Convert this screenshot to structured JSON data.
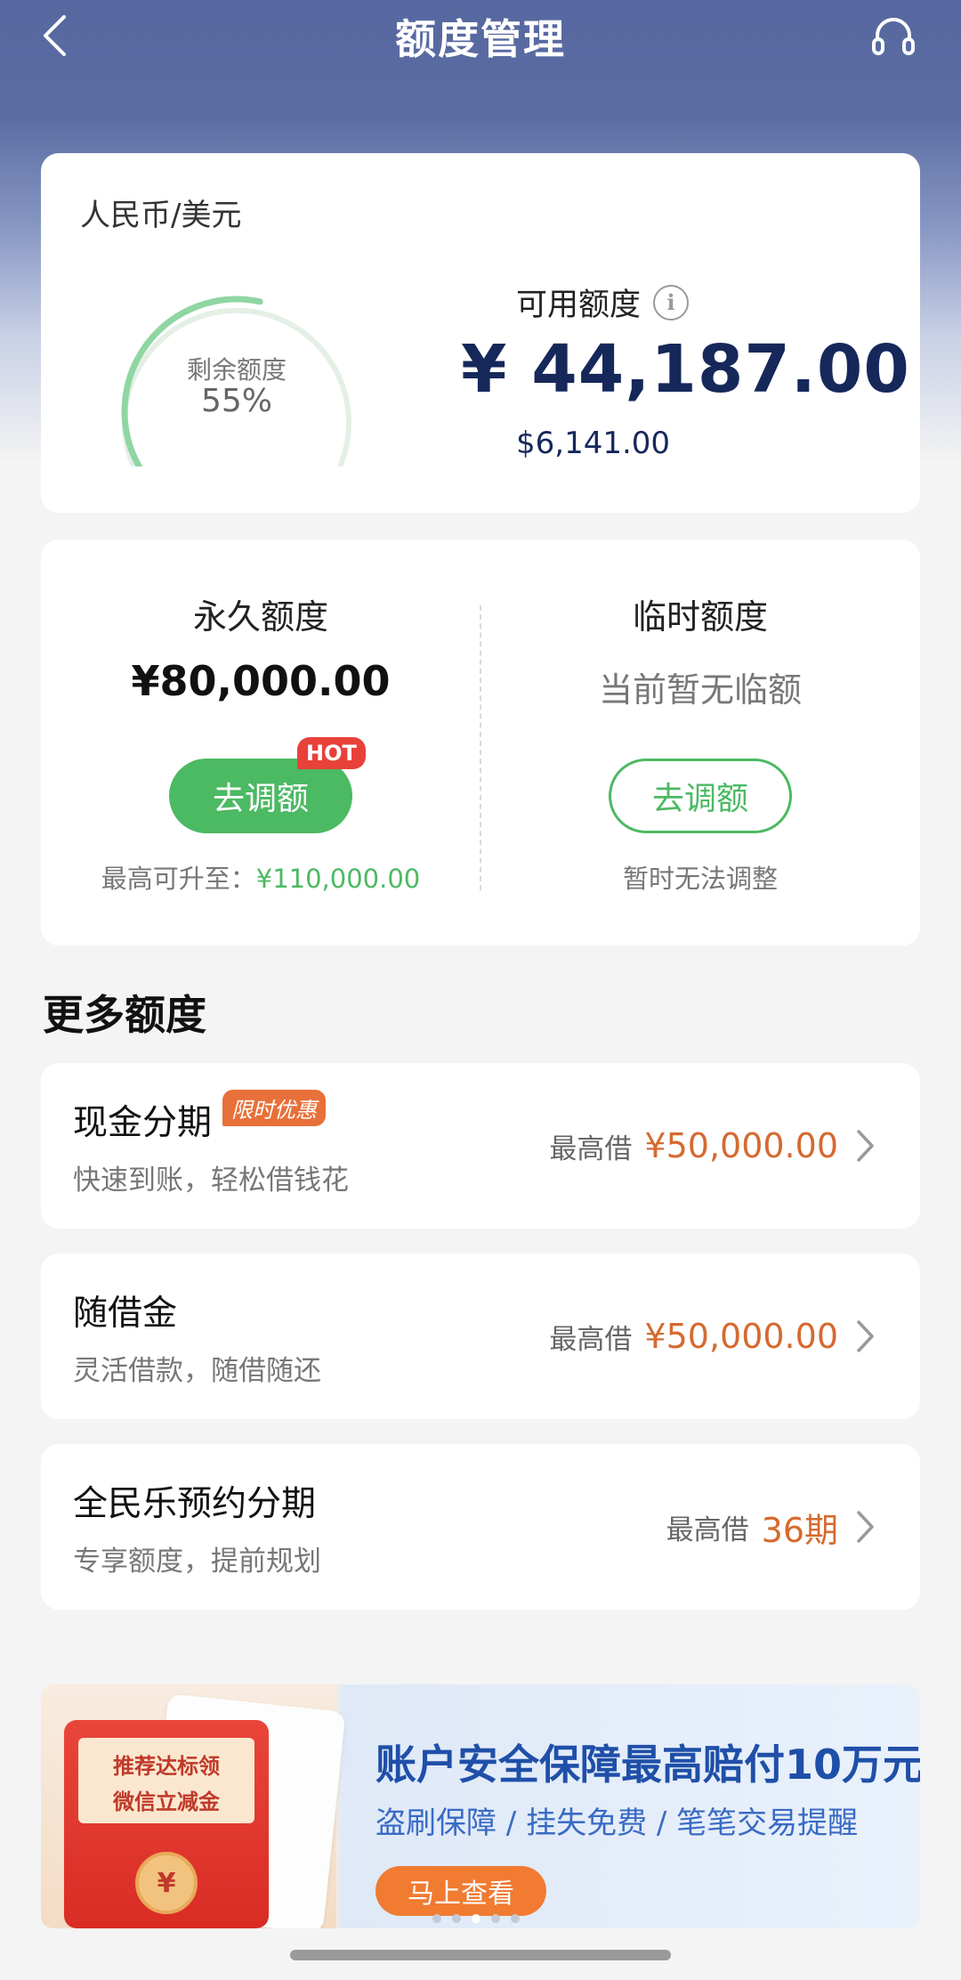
{
  "header": {
    "title": "额度管理"
  },
  "summary": {
    "currency_label": "人民币/美元",
    "gauge_label": "剩余额度",
    "gauge_percent": "55%",
    "gauge_fraction": 0.55,
    "available_label": "可用额度",
    "available_amount": "¥ 44,187.00",
    "available_usd": "$6,141.00"
  },
  "limits": {
    "permanent": {
      "title": "永久额度",
      "amount": "¥80,000.00",
      "button": "去调额",
      "badge": "HOT",
      "note_prefix": "最高可升至：",
      "note_value": "¥110,000.00"
    },
    "temporary": {
      "title": "临时额度",
      "status": "当前暂无临额",
      "button": "去调额",
      "note": "暂时无法调整"
    }
  },
  "more": {
    "title": "更多额度",
    "items": [
      {
        "title": "现金分期",
        "badge": "限时优惠",
        "subtitle": "快速到账，轻松借钱花",
        "right_label": "最高借",
        "right_value": "¥50,000.00"
      },
      {
        "title": "随借金",
        "badge": "",
        "subtitle": "灵活借款，随借随还",
        "right_label": "最高借",
        "right_value": "¥50,000.00"
      },
      {
        "title": "全民乐预约分期",
        "badge": "",
        "subtitle": "专享额度，提前规划",
        "right_label": "最高借",
        "right_value": "36期"
      }
    ]
  },
  "banner": {
    "envelope_line1": "推荐达标领",
    "envelope_line2": "微信立减金",
    "coin": "¥",
    "title": "账户安全保障最高赔付10万元",
    "subtitle": "盗刷保障 / 挂失免费 / 笔笔交易提醒",
    "button": "马上查看"
  },
  "colors": {
    "header_bg": "#56689f",
    "accent_green": "#4cb963",
    "amount_navy": "#16285a",
    "orange_value": "#d56a2f",
    "hot_red": "#e8413a"
  }
}
